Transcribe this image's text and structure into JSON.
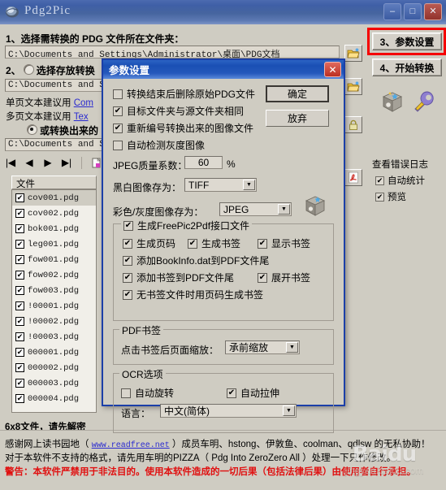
{
  "window": {
    "title": "Pdg2Pic",
    "icon": "app-globe-icon",
    "minimize": "–",
    "maximize": "□",
    "close": "✕"
  },
  "main": {
    "step1_label": "1、选择需转换的 PDG 文件所在文件夹：",
    "path1": "C:\\Documents and Settings\\Administrator\\桌面\\PDG文档",
    "step2_label": "2、",
    "step2_radio_label": "选择存放转换",
    "step2_radio_checked": false,
    "path2": "C:\\Documents and S",
    "hint1_prefix": "单页文本建议用 ",
    "hint1_link": "Com",
    "hint2_prefix": "多页文本建议用 ",
    "hint2_link": "Tex",
    "step2b_radio_label": "或转换出来的",
    "step2b_radio_checked": true,
    "path3": "C:\\Documents and S",
    "nav": {
      "first": "|◀",
      "prev": "◀",
      "next": "▶",
      "last": "▶|",
      "page_icon": "page-icon",
      "check_icon": "checkmark-icon"
    },
    "list_header": "文件",
    "files": [
      {
        "name": "cov001.pdg",
        "checked": true,
        "selected": true
      },
      {
        "name": "cov002.pdg",
        "checked": true,
        "selected": false
      },
      {
        "name": "bok001.pdg",
        "checked": true,
        "selected": false
      },
      {
        "name": "leg001.pdg",
        "checked": true,
        "selected": false
      },
      {
        "name": "fow001.pdg",
        "checked": true,
        "selected": false
      },
      {
        "name": "fow002.pdg",
        "checked": true,
        "selected": false
      },
      {
        "name": "fow003.pdg",
        "checked": true,
        "selected": false
      },
      {
        "name": "!00001.pdg",
        "checked": true,
        "selected": false
      },
      {
        "name": "!00002.pdg",
        "checked": true,
        "selected": false
      },
      {
        "name": "!00003.pdg",
        "checked": true,
        "selected": false
      },
      {
        "name": "000001.pdg",
        "checked": true,
        "selected": false
      },
      {
        "name": "000002.pdg",
        "checked": true,
        "selected": false
      },
      {
        "name": "000003.pdg",
        "checked": true,
        "selected": false
      },
      {
        "name": "000004.pdg",
        "checked": true,
        "selected": false
      }
    ],
    "decrypt_note": "6x8文件，请先解密"
  },
  "right_panel": {
    "params_button": "3、参数设置",
    "start_button": "4、开始转换",
    "browse_icon_1": "open-folder-icon",
    "browse_icon_2": "open-folder-icon",
    "lock_icon": "lock-icon",
    "pdf_icon": "pdf-icon",
    "cube_icon": "cube-icon",
    "wrench_icon": "wrench-icon",
    "error_log_label": "查看错误日志",
    "auto_stat_label": "自动统计",
    "auto_stat_checked": true,
    "preview_label": "预览",
    "preview_checked": true
  },
  "dialog": {
    "title": "参数设置",
    "close": "✕",
    "checkboxes": [
      {
        "label": "转换结束后删除原始PDG文件",
        "checked": false
      },
      {
        "label": "目标文件夹与源文件夹相同",
        "checked": true
      },
      {
        "label": "重新编号转换出来的图像文件",
        "checked": true
      },
      {
        "label": "自动检测灰度图像",
        "checked": false
      }
    ],
    "ok_button": "确定",
    "cancel_button": "放弃",
    "jpeg_quality_label": "JPEG质量系数：",
    "jpeg_quality_value": "60",
    "jpeg_quality_unit": "%",
    "bw_format_label": "黑白图像存为：",
    "bw_format_value": "TIFF",
    "color_format_label": "彩色/灰度图像存为：",
    "color_format_value": "JPEG",
    "freepic": {
      "main_label": "生成FreePic2Pdf接口文件",
      "main_checked": true,
      "items": [
        {
          "label": "生成页码",
          "checked": true
        },
        {
          "label": "生成书签",
          "checked": true
        },
        {
          "label": "显示书签",
          "checked": true
        },
        {
          "label": "添加BookInfo.dat到PDF文件尾",
          "checked": true
        },
        {
          "label": "添加书签到PDF文件尾",
          "checked": true
        },
        {
          "label": "展开书签",
          "checked": true
        },
        {
          "label": "无书签文件时用页码生成书签",
          "checked": true
        }
      ]
    },
    "pdf_bookmark": {
      "group_label": "PDF书签",
      "zoom_label": "点击书签后页面缩放：",
      "zoom_value": "承前缩放"
    },
    "ocr": {
      "group_label": "OCR选项",
      "auto_rotate_label": "自动旋转",
      "auto_rotate_checked": false,
      "auto_stretch_label": "自动拉伸",
      "auto_stretch_checked": true,
      "language_label": "语言：",
      "language_value": "中文(简体)"
    }
  },
  "credits": {
    "line1_a": "感谢网上读书园地（ ",
    "line1_link": "www.readfree.net",
    "line1_b": " ）成员车明、hstong、伊敦鱼、coolman、qdlsw 的无私协助！",
    "line2": "对于本软件不支持的格式，请先用车明的PIZZA（ Pdg Into ZeroZero All ）处理一下只作修改。",
    "line3": "警告：本软件严禁用于非法目的。使用本软件造成的一切后果（包括法律后果）由使用者自行承担。",
    "watermark_main": "Baidu",
    "watermark_sub": "jingyan.baidu.com"
  },
  "colors": {
    "accent_red": "#f50000",
    "title_blue": "#1a4fb4",
    "warning_red": "#e01010",
    "link_blue": "#2a2ad0",
    "face": "#cfccc2"
  }
}
